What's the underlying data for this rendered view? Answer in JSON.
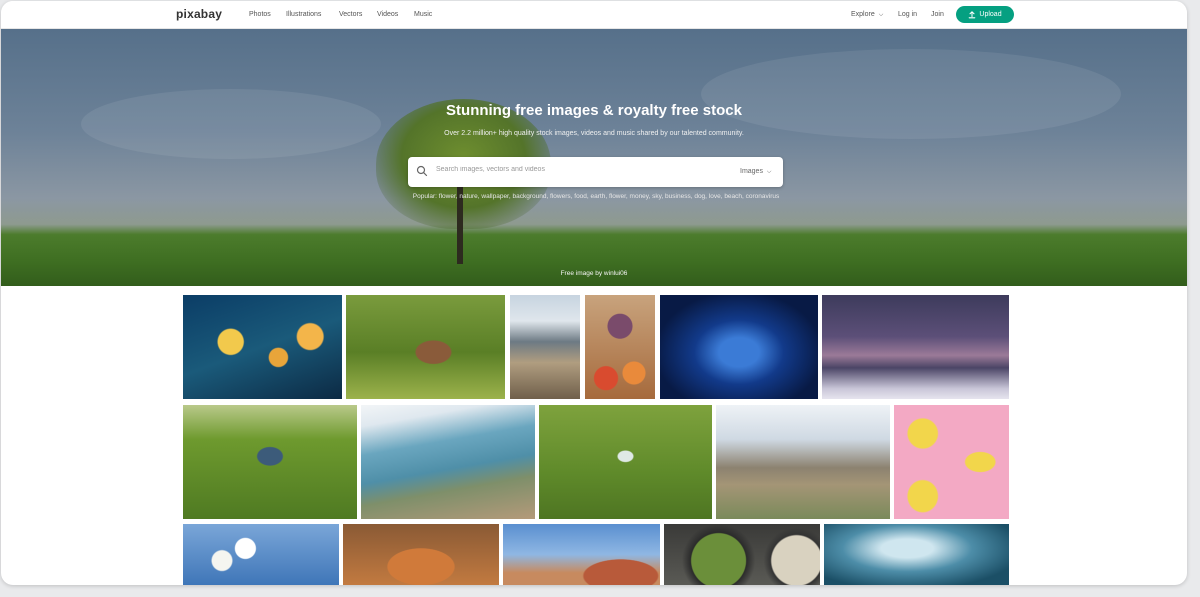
{
  "header": {
    "logo": "pixabay",
    "nav": [
      "Photos",
      "Illustrations",
      "Vectors",
      "Videos",
      "Music"
    ],
    "explore": "Explore",
    "login": "Log in",
    "join": "Join",
    "upload": "Upload"
  },
  "hero": {
    "title": "Stunning free images & royalty free stock",
    "subtitle": "Over 2.2 million+ high quality stock images, videos and music shared by our talented community.",
    "search_placeholder": "Search images, vectors and videos",
    "search_type": "Images",
    "popular_tags": "Popular: flower, nature, wallpaper, background, flowers, food, earth, flower, money, sky, business, dog, love, beach, coronavirus",
    "credit": "Free image by winlui06"
  },
  "colors": {
    "accent": "#05a081"
  },
  "gallery": [
    "bokeh-lights-rain-window",
    "woman-in-grass-field",
    "mountain-road-snow",
    "fruit-basket",
    "blue-tunnel-station",
    "purple-mountains-night",
    "couple-hugging-meadow",
    "coastal-bay-aerial",
    "butterfly-on-grass",
    "mountain-valley-clouds",
    "lemon-pattern-pink",
    "white-blossoms-sky",
    "ginger-cat",
    "florence-cathedral",
    "salad-bowls",
    "aerial-sky-figure"
  ]
}
